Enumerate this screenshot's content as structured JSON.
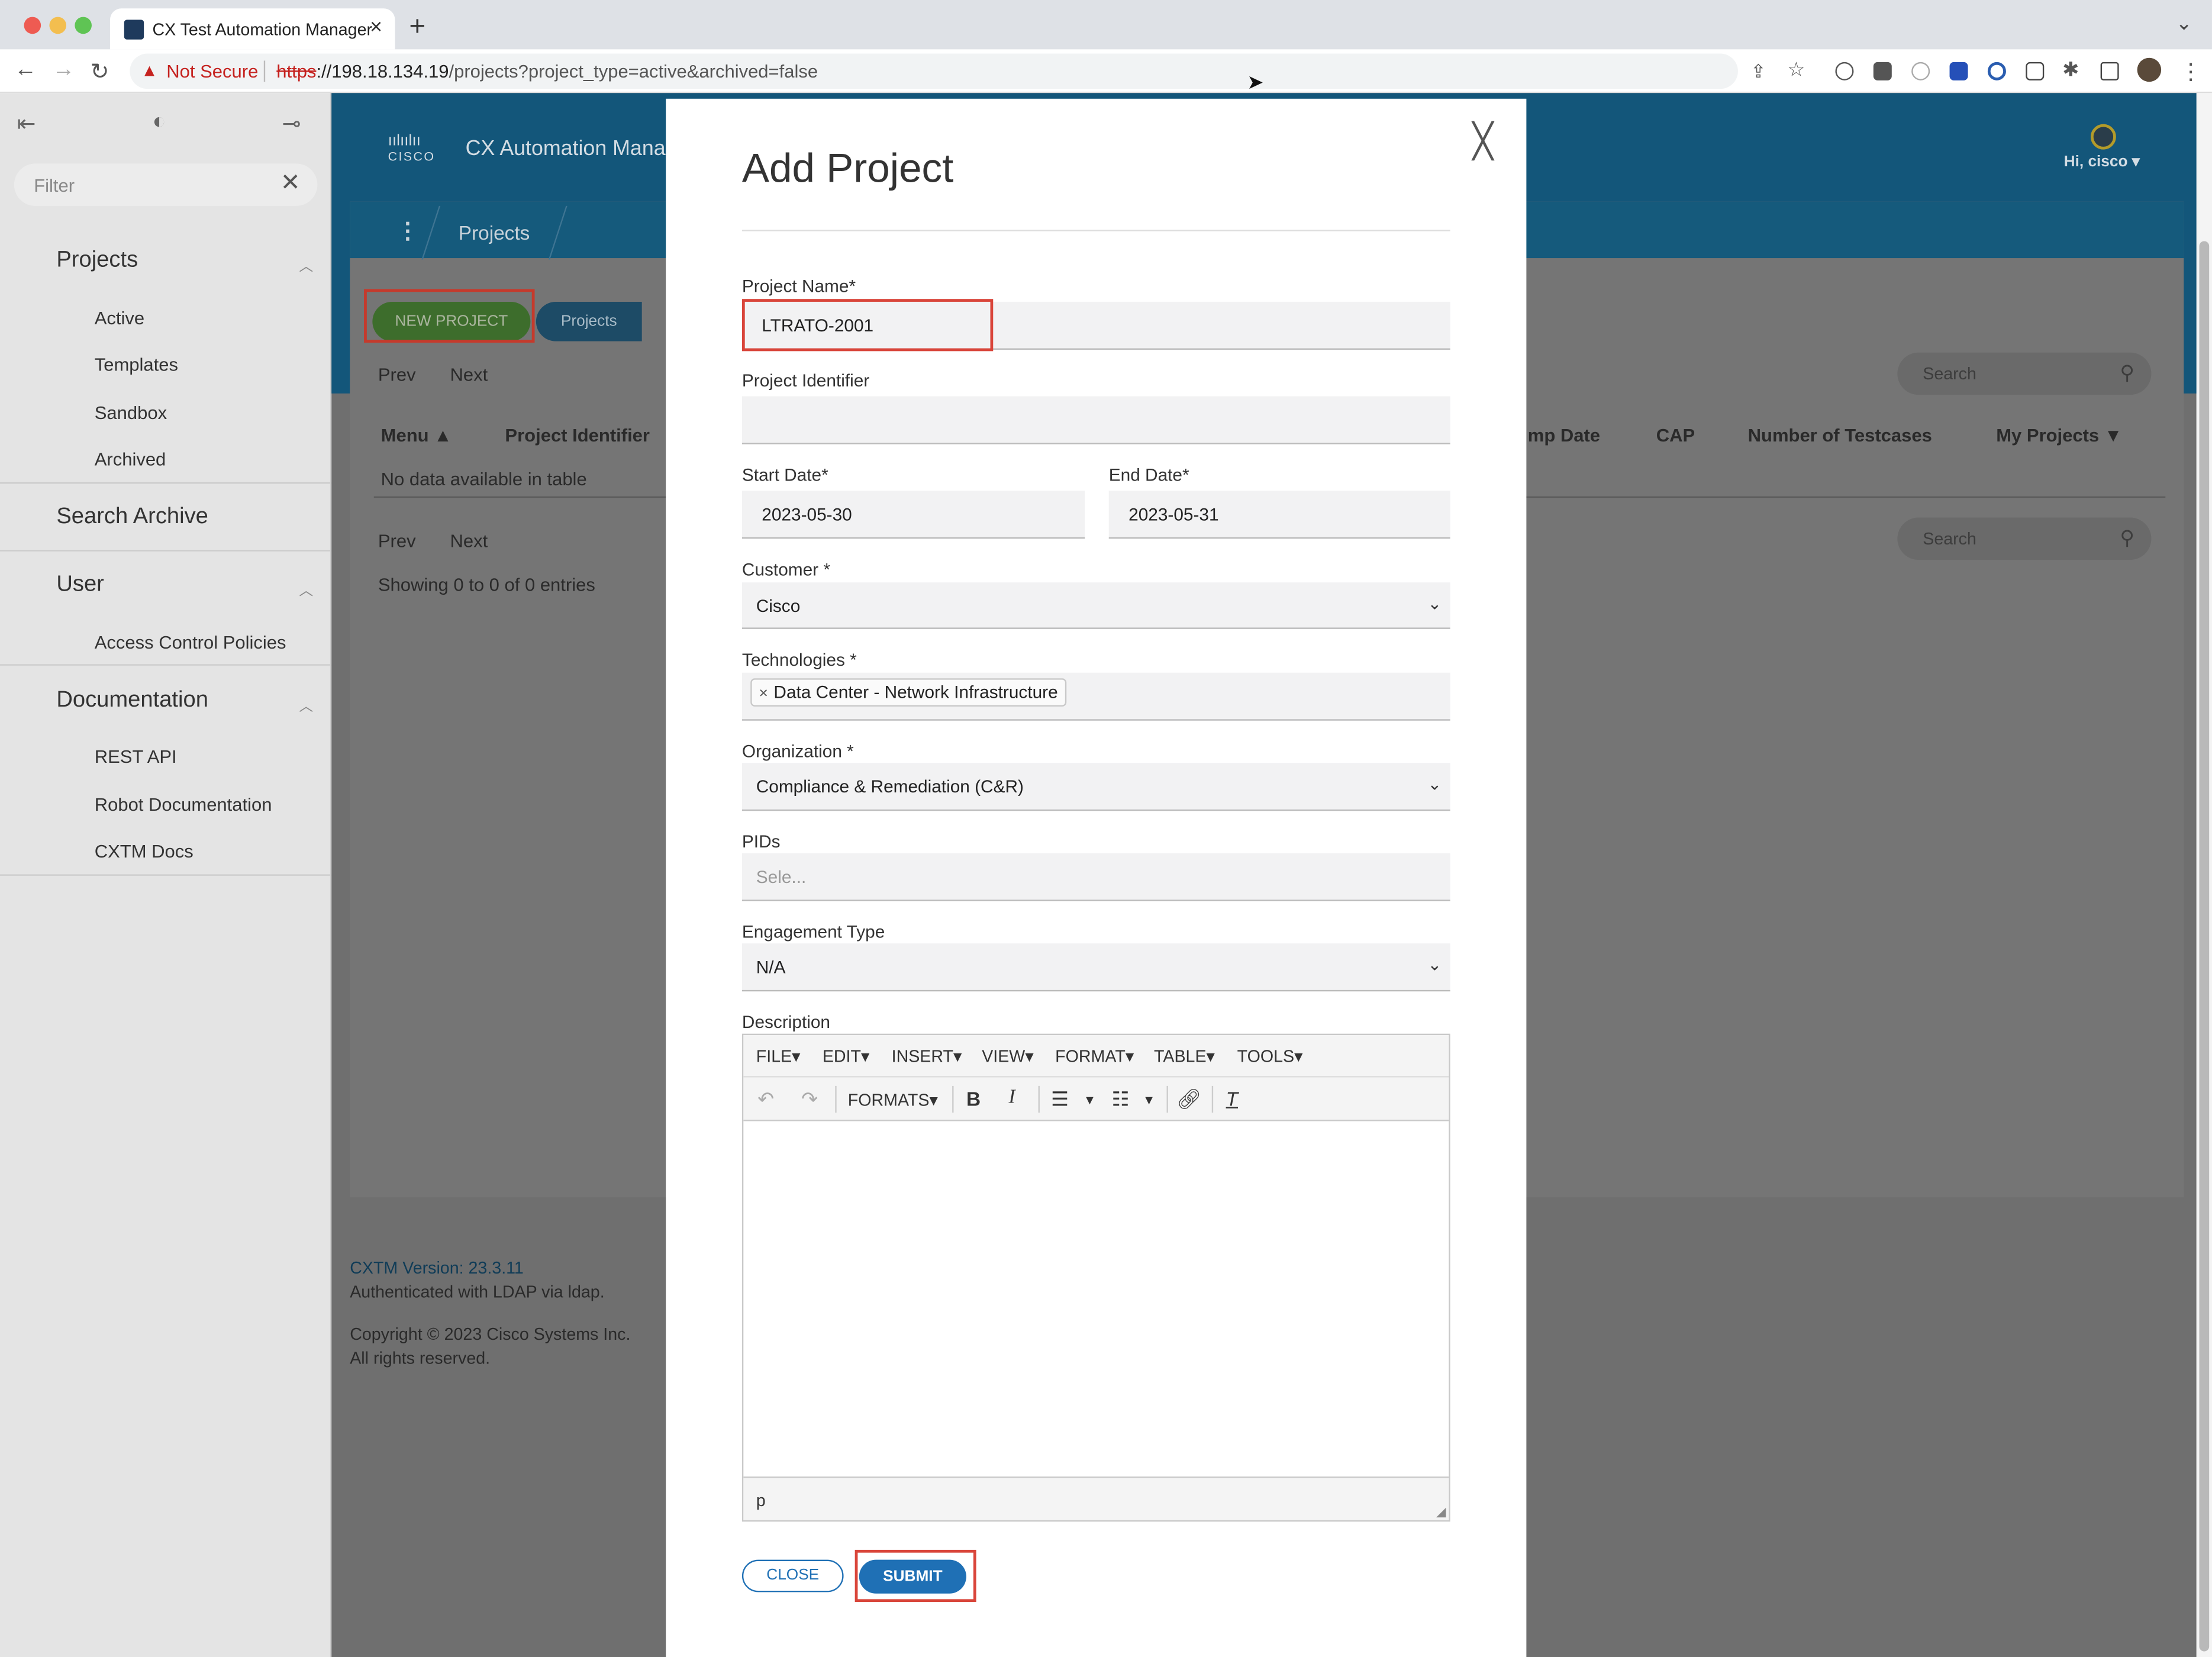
{
  "browser": {
    "tab_title": "CX Test Automation Manager",
    "new_tab": "+",
    "security_label": "Not Secure",
    "url_scheme": "https",
    "url_host": "://198.18.134.19",
    "url_path": "/projects?project_type=active&archived=false"
  },
  "sidebar": {
    "filter_placeholder": "Filter",
    "sections": {
      "projects": "Projects",
      "search_archive": "Search Archive",
      "user": "User",
      "documentation": "Documentation"
    },
    "projects_items": [
      "Active",
      "Templates",
      "Sandbox",
      "Archived"
    ],
    "user_items": [
      "Access Control Policies"
    ],
    "documentation_items": [
      "REST API",
      "Robot Documentation",
      "CXTM Docs"
    ]
  },
  "app": {
    "logo_text": "CISCO",
    "title": "CX Automation Manager",
    "user_greeting": "Hi, cisco ▾",
    "breadcrumb": "Projects",
    "new_project_button": "NEW PROJECT",
    "projects_toggle": "Projects",
    "prev": "Prev",
    "next": "Next",
    "search_placeholder": "Search",
    "columns": [
      "Menu ▲",
      "Project Identifier",
      "mp Date",
      "CAP",
      "Number of Testcases",
      "My Projects ▼"
    ],
    "empty_message": "No data available in table",
    "showing": "Showing 0 to 0 of 0 entries",
    "footer": {
      "version": "CXTM Version: 23.3.11",
      "auth": "Authenticated with LDAP via ldap.",
      "copyright": "Copyright © 2023 Cisco Systems Inc.",
      "rights": "All rights reserved."
    }
  },
  "modal": {
    "title": "Add Project",
    "project_name_label": "Project Name*",
    "project_name_value": "LTRATO-2001",
    "project_identifier_label": "Project Identifier",
    "project_identifier_value": "",
    "start_date_label": "Start Date*",
    "start_date_value": "2023-05-30",
    "end_date_label": "End Date*",
    "end_date_value": "2023-05-31",
    "customer_label": "Customer *",
    "customer_value": "Cisco",
    "technologies_label": "Technologies *",
    "technologies_tags": [
      "Data Center - Network Infrastructure"
    ],
    "organization_label": "Organization *",
    "organization_value": "Compliance & Remediation (C&R)",
    "pids_label": "PIDs",
    "pids_placeholder": "Sele...",
    "engagement_type_label": "Engagement Type",
    "engagement_type_value": "N/A",
    "description_label": "Description",
    "editor_menus": [
      "FILE",
      "EDIT",
      "INSERT",
      "VIEW",
      "FORMAT",
      "TABLE",
      "TOOLS"
    ],
    "formats_label": "FORMATS",
    "editor_status_path": "p",
    "close_button": "CLOSE",
    "submit_button": "SUBMIT"
  }
}
